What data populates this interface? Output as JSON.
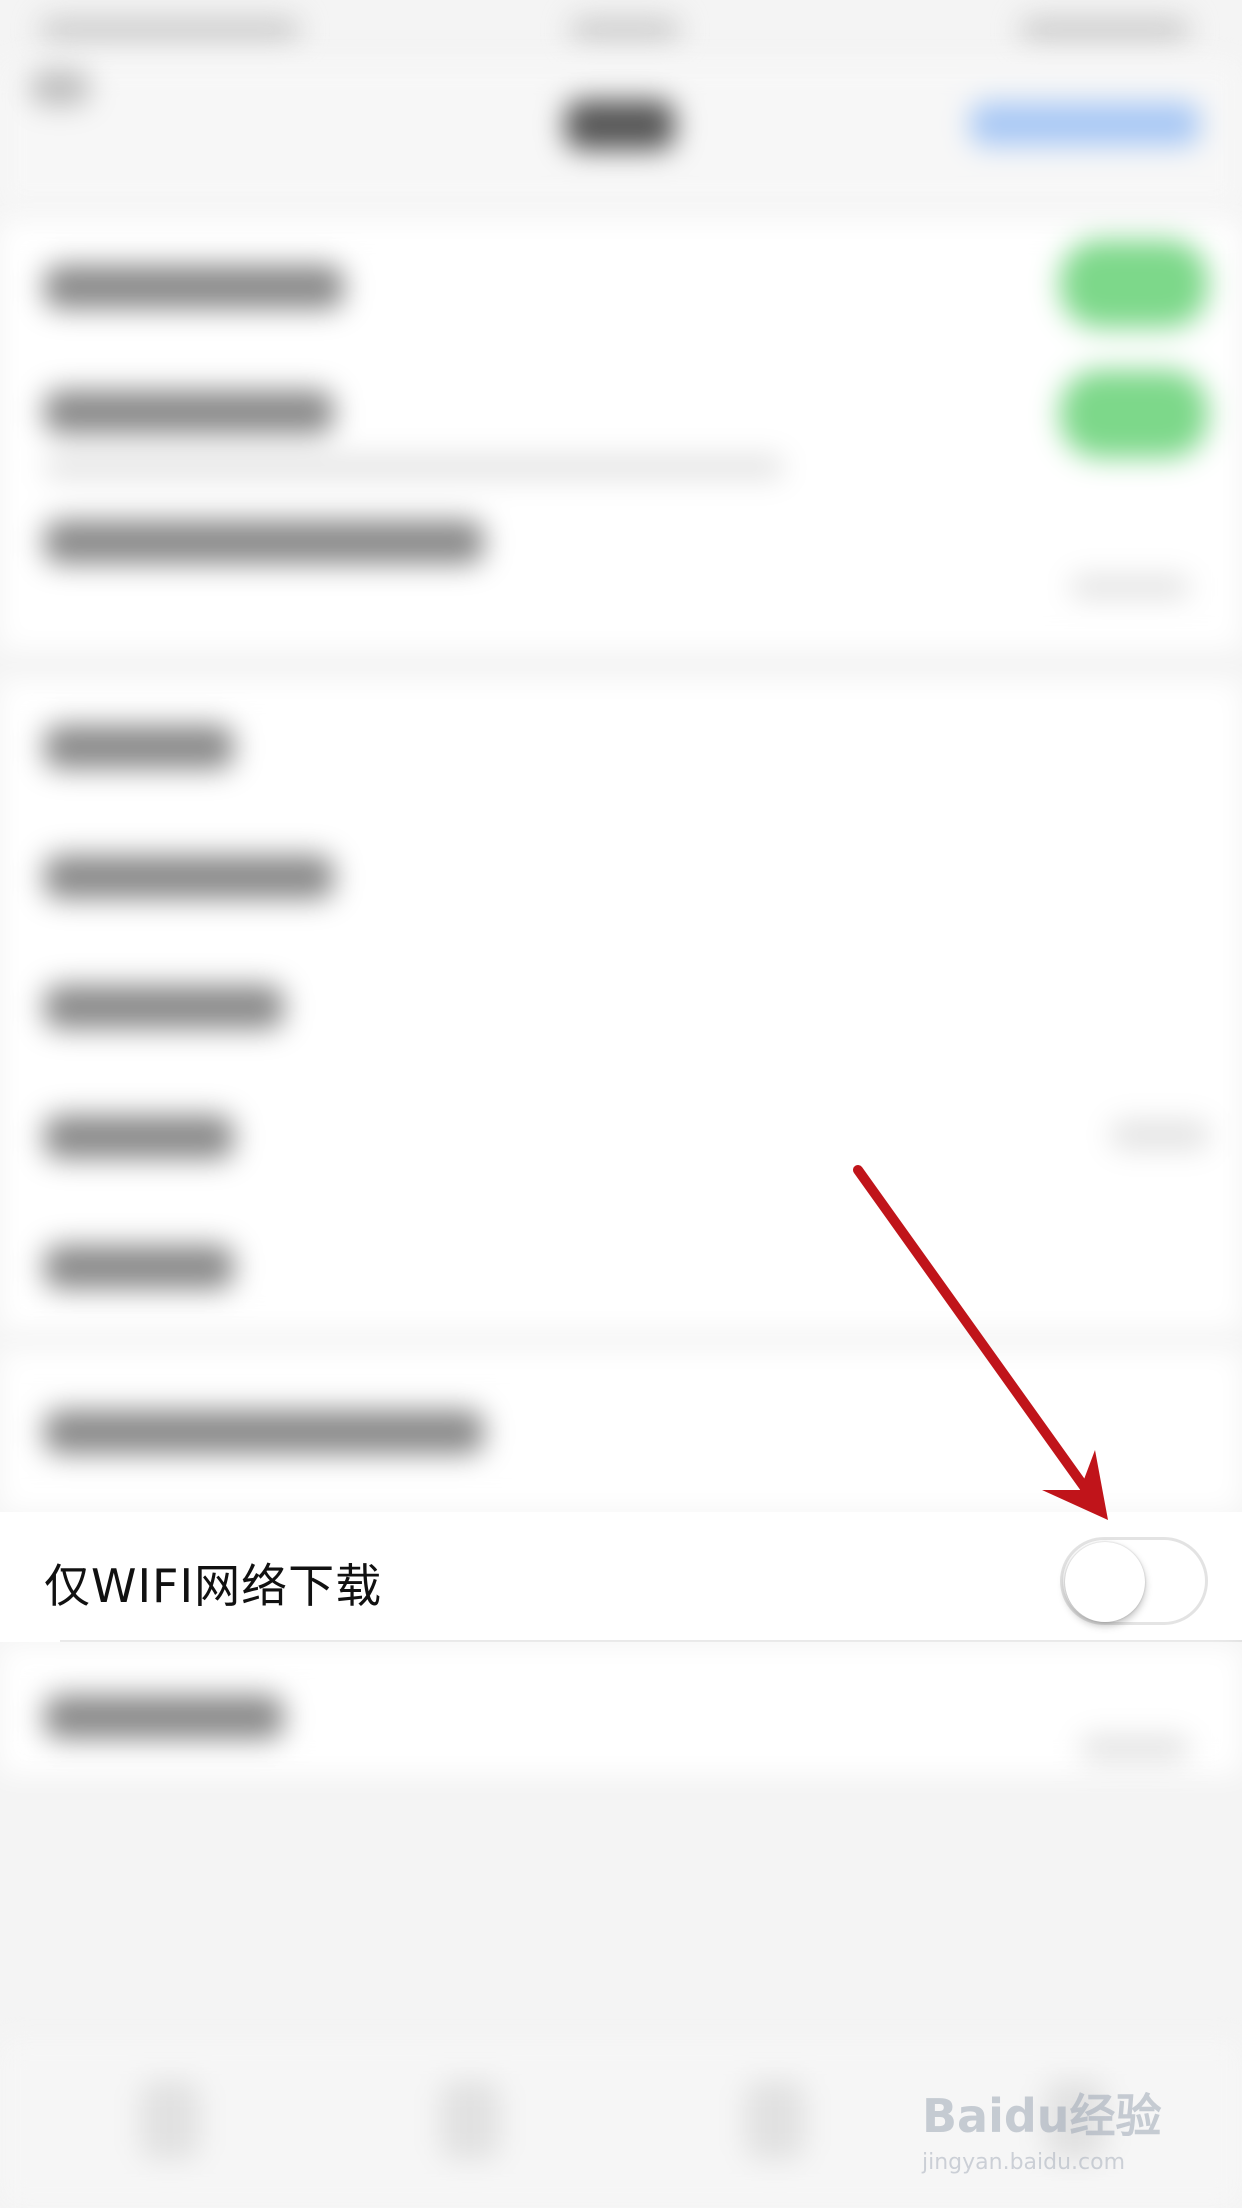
{
  "setting_row": {
    "label": "仅WIFI网络下载",
    "toggle_on": false
  },
  "watermark": {
    "logo": "Baidu经验",
    "url": "jingyan.baidu.com"
  },
  "colors": {
    "toggle_on": "#6fd47d",
    "annotation_arrow": "#c0141a"
  }
}
